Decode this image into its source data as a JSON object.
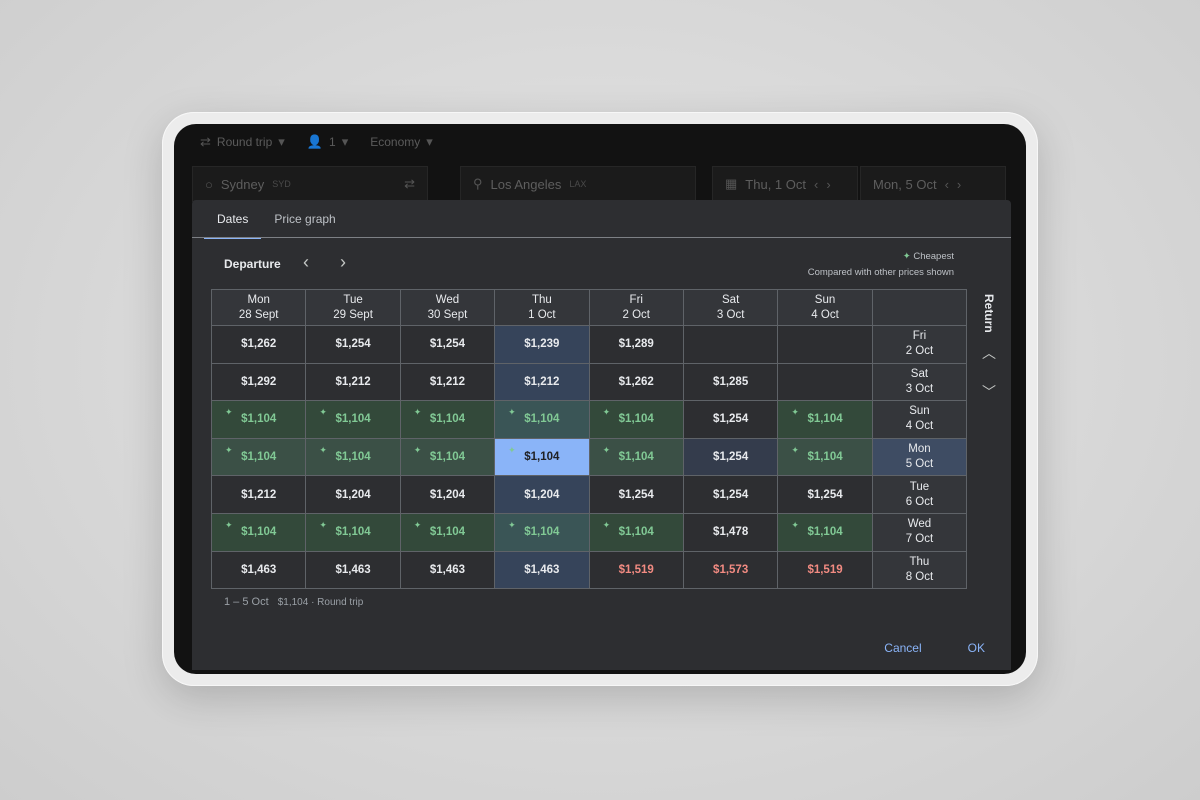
{
  "search_bar": {
    "trip_type": "Round trip",
    "passengers": "1",
    "cabin": "Economy",
    "origin_city": "Sydney",
    "origin_code": "SYD",
    "destination_city": "Los Angeles",
    "destination_code": "LAX",
    "depart_date": "Thu, 1 Oct",
    "return_date": "Mon, 5 Oct"
  },
  "tabs": [
    {
      "label": "Dates"
    },
    {
      "label": "Price graph"
    }
  ],
  "departure_label": "Departure",
  "return_label": "Return",
  "legend": {
    "cheapest": "Cheapest",
    "note": "Compared with other prices shown"
  },
  "columns": [
    {
      "day": "Mon",
      "date": "28 Sept"
    },
    {
      "day": "Tue",
      "date": "29 Sept"
    },
    {
      "day": "Wed",
      "date": "30 Sept"
    },
    {
      "day": "Thu",
      "date": "1 Oct"
    },
    {
      "day": "Fri",
      "date": "2 Oct"
    },
    {
      "day": "Sat",
      "date": "3 Oct"
    },
    {
      "day": "Sun",
      "date": "4 Oct"
    }
  ],
  "rows": [
    {
      "day": "Fri",
      "date": "2 Oct",
      "prices": [
        "$1,262",
        "$1,254",
        "$1,254",
        "$1,239",
        "$1,289",
        "",
        ""
      ]
    },
    {
      "day": "Sat",
      "date": "3 Oct",
      "prices": [
        "$1,292",
        "$1,212",
        "$1,212",
        "$1,212",
        "$1,262",
        "$1,285",
        ""
      ]
    },
    {
      "day": "Sun",
      "date": "4 Oct",
      "prices": [
        "$1,104",
        "$1,104",
        "$1,104",
        "$1,104",
        "$1,104",
        "$1,254",
        "$1,104"
      ]
    },
    {
      "day": "Mon",
      "date": "5 Oct",
      "prices": [
        "$1,104",
        "$1,104",
        "$1,104",
        "$1,104",
        "$1,104",
        "$1,254",
        "$1,104"
      ]
    },
    {
      "day": "Tue",
      "date": "6 Oct",
      "prices": [
        "$1,212",
        "$1,204",
        "$1,204",
        "$1,204",
        "$1,254",
        "$1,254",
        "$1,254"
      ]
    },
    {
      "day": "Wed",
      "date": "7 Oct",
      "prices": [
        "$1,104",
        "$1,104",
        "$1,104",
        "$1,104",
        "$1,104",
        "$1,478",
        "$1,104"
      ]
    },
    {
      "day": "Thu",
      "date": "8 Oct",
      "prices": [
        "$1,463",
        "$1,463",
        "$1,463",
        "$1,463",
        "$1,519",
        "$1,573",
        "$1,519"
      ]
    }
  ],
  "cheap_price": "$1,104",
  "high_prices": [
    "$1,519",
    "$1,573"
  ],
  "selected": {
    "row": 3,
    "col": 3
  },
  "summary": {
    "dates": "1 – 5 Oct",
    "detail": "$1,104 · Round trip"
  },
  "buttons": {
    "cancel": "Cancel",
    "ok": "OK"
  },
  "colors": {
    "accent": "#8ab4f8",
    "cheap": "#81c995",
    "high": "#f28b82"
  }
}
